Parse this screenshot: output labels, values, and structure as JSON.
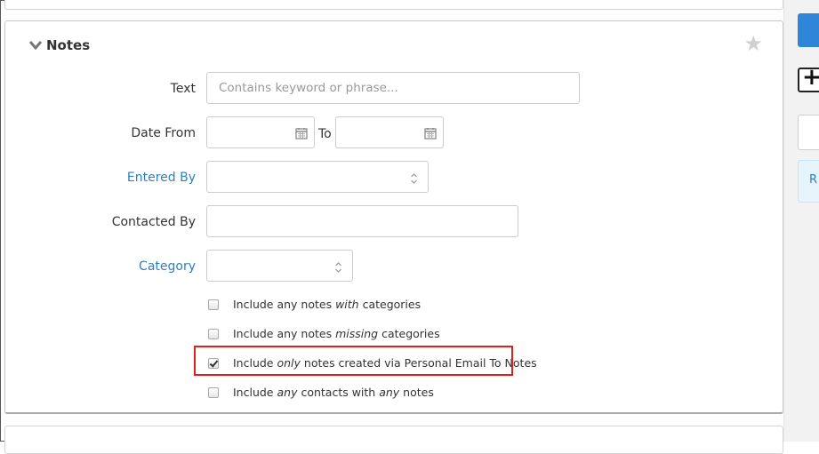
{
  "notes_panel": {
    "title": "Notes",
    "fields": {
      "text": {
        "label": "Text",
        "placeholder": "Contains keyword or phrase...",
        "value": ""
      },
      "date_from": {
        "label": "Date From",
        "value": ""
      },
      "date_to": {
        "label": "To",
        "value": ""
      },
      "entered_by": {
        "label": "Entered By",
        "value": ""
      },
      "contacted_by": {
        "label": "Contacted By",
        "value": ""
      },
      "category": {
        "label": "Category",
        "value": ""
      }
    },
    "checkboxes": [
      {
        "pre": "Include any notes ",
        "em": "with",
        "post": " categories",
        "checked": false
      },
      {
        "pre": "Include any notes ",
        "em": "missing",
        "post": " categories",
        "checked": false
      },
      {
        "pre": "Include ",
        "em": "only",
        "post": " notes created via Personal Email To Notes",
        "checked": true
      },
      {
        "pre": "Include ",
        "em": "any",
        "mid": " contacts with ",
        "em2": "any",
        "post": " notes",
        "checked": false
      }
    ]
  },
  "right_column": {
    "plus_label": "+",
    "info_label": "R"
  },
  "colors": {
    "link_label": "#2f7fc1",
    "highlight": "#e0201b",
    "primary_button": "#2f86d8"
  },
  "icons": [
    "chevron-down-icon",
    "star-icon",
    "calendar-icon",
    "select-arrows-icon",
    "checkmark-icon",
    "plus-icon"
  ]
}
